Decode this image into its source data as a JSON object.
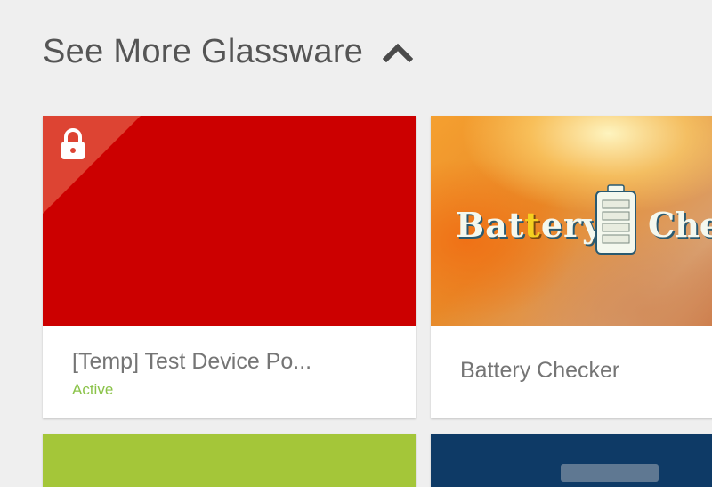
{
  "section": {
    "title": "See More Glassware",
    "toggle_icon": "chevron-up-icon"
  },
  "cards": [
    {
      "title": "[Temp] Test Device Po...",
      "status": "Active",
      "image_color": "#cc0000",
      "badge_icon": "lock-icon",
      "badge_color": "#dd4433"
    },
    {
      "title": "Battery Checker",
      "logo_prefix": "Bat",
      "logo_bolt": "t",
      "logo_suffix": "ery",
      "logo_tail": "Che",
      "logo_icon": "battery-icon"
    },
    {
      "image_color": "#a4c639"
    },
    {
      "image_color": "#0e3a66"
    }
  ],
  "colors": {
    "background": "#efefef",
    "status_active": "#8bc34a",
    "title_text": "#555555",
    "card_text": "#757575"
  }
}
